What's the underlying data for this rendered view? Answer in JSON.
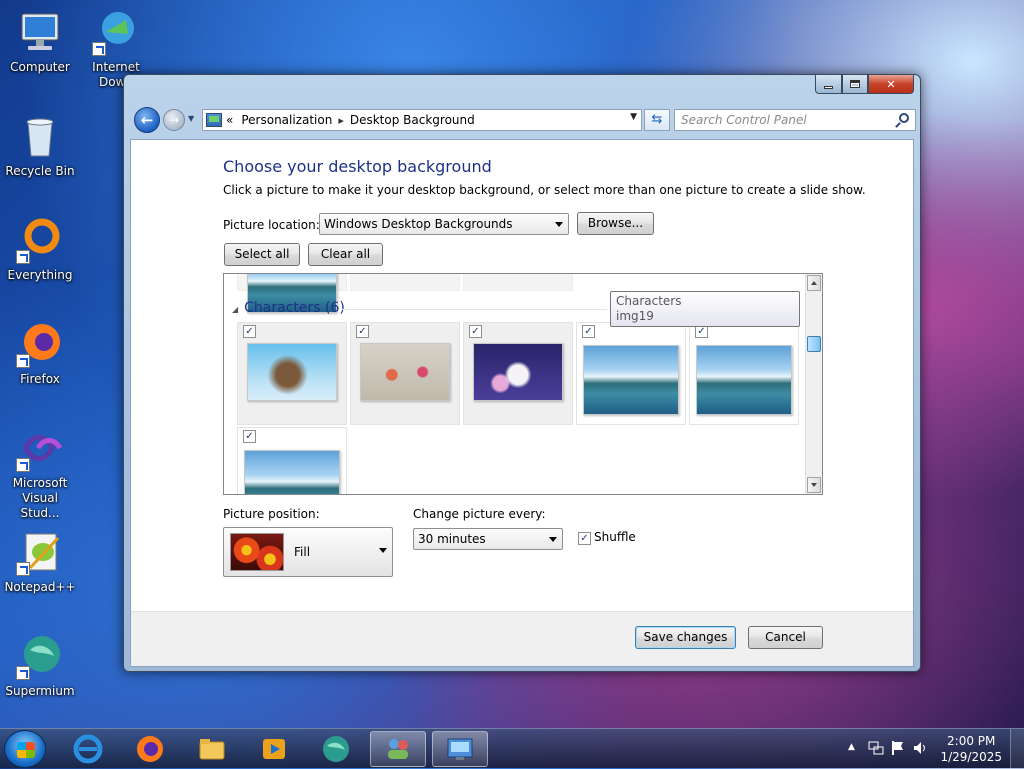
{
  "desktop": {
    "icons": [
      {
        "label": "Computer",
        "icon": "computer-icon"
      },
      {
        "label": "Internet Down",
        "icon": "internet-download-manager-icon"
      },
      {
        "label": "Recycle Bin",
        "icon": "recycle-bin-icon"
      },
      {
        "label": "Everything",
        "icon": "everything-search-icon"
      },
      {
        "label": "Firefox",
        "icon": "firefox-icon"
      },
      {
        "label": "Microsoft Visual Stud...",
        "icon": "visual-studio-icon"
      },
      {
        "label": "Notepad++",
        "icon": "notepadpp-icon"
      },
      {
        "label": "Supermium",
        "icon": "supermium-icon"
      }
    ]
  },
  "window": {
    "breadcrumb": [
      "Personalization",
      "Desktop Background"
    ],
    "breadcrumb_prefix": "«",
    "search_placeholder": "Search Control Panel",
    "heading": "Choose your desktop background",
    "description": "Click a picture to make it your desktop background, or select more than one picture to create a slide show.",
    "picture_location_label": "Picture location:",
    "picture_location_value": "Windows Desktop Backgrounds",
    "browse_label": "Browse...",
    "select_all_label": "Select all",
    "clear_all_label": "Clear all",
    "gallery": {
      "group_title": "Characters (6)",
      "tooltip_line1": "Characters",
      "tooltip_line2": "img19",
      "items": [
        {
          "name": "img-character-1",
          "checked": true
        },
        {
          "name": "img-character-2",
          "checked": true
        },
        {
          "name": "img-character-3",
          "checked": true
        },
        {
          "name": "img-landscape-1",
          "checked": true
        },
        {
          "name": "img-landscape-2",
          "checked": true
        },
        {
          "name": "img-landscape-3",
          "checked": true
        }
      ]
    },
    "picture_position_label": "Picture position:",
    "picture_position_value": "Fill",
    "change_every_label": "Change picture every:",
    "change_every_value": "30 minutes",
    "shuffle_label": "Shuffle",
    "shuffle_checked": true,
    "save_label": "Save changes",
    "cancel_label": "Cancel"
  },
  "taskbar": {
    "time": "2:00 PM",
    "date": "1/29/2025",
    "apps": [
      "internet-explorer-icon",
      "firefox-icon",
      "file-explorer-icon",
      "media-player-icon",
      "supermium-icon",
      "users-app-icon",
      "control-panel-icon"
    ]
  },
  "colors": {
    "heading": "#1e3287",
    "primary_button_border": "#3c7fb1"
  }
}
